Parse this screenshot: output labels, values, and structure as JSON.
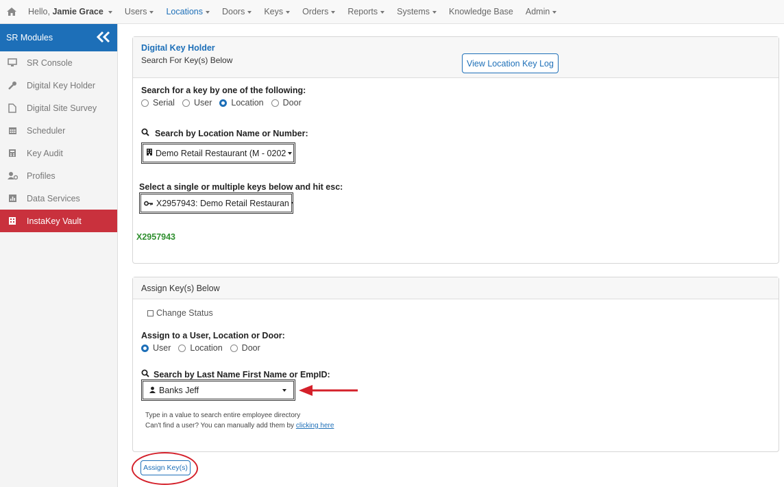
{
  "topnav": {
    "hello_prefix": "Hello,",
    "user_name": "Jamie Grace",
    "items": [
      "Users",
      "Locations",
      "Doors",
      "Keys",
      "Orders",
      "Reports",
      "Systems",
      "Knowledge Base",
      "Admin"
    ]
  },
  "sidebar": {
    "header": "SR Modules",
    "items": [
      {
        "label": "SR Console",
        "icon": "monitor-icon"
      },
      {
        "label": "Digital Key Holder",
        "icon": "wrench-icon"
      },
      {
        "label": "Digital Site Survey",
        "icon": "file-icon"
      },
      {
        "label": "Scheduler",
        "icon": "calendar-icon"
      },
      {
        "label": "Key Audit",
        "icon": "calculator-icon"
      },
      {
        "label": "Profiles",
        "icon": "users-gear-icon"
      },
      {
        "label": "Data Services",
        "icon": "chart-icon"
      },
      {
        "label": "InstaKey Vault",
        "icon": "vault-icon",
        "active": true
      }
    ]
  },
  "search_card": {
    "title": "Digital Key Holder",
    "subtitle": "Search For Key(s) Below",
    "view_log_button": "View Location Key Log",
    "search_by_label": "Search for a key by one of the following:",
    "search_options": [
      "Serial",
      "User",
      "Location",
      "Door"
    ],
    "search_selected": "Location",
    "location_search_label": "Search by Location Name or Number:",
    "location_value": "Demo Retail Restaurant (M - 0202",
    "keys_label": "Select a single or multiple keys below and hit esc:",
    "keys_value": "X2957943: Demo Retail Restauran",
    "selected_key": "X2957943"
  },
  "assign_card": {
    "title": "Assign Key(s) Below",
    "change_status_label": "Change Status",
    "assign_to_label": "Assign to a User, Location or Door:",
    "assign_options": [
      "User",
      "Location",
      "Door"
    ],
    "assign_selected": "User",
    "user_search_label": "Search by Last Name First Name or EmpID:",
    "user_value": "Banks Jeff",
    "help_line1": "Type in a value to search entire employee directory",
    "help_line2": "Can't find a user? You can manually add them by",
    "help_link": "clicking here"
  },
  "assign_button": "Assign Key(s)",
  "colors": {
    "primary": "#1d6fb8",
    "active": "#c9313d",
    "annotation": "#d4202a",
    "success": "#2f8f2f"
  }
}
